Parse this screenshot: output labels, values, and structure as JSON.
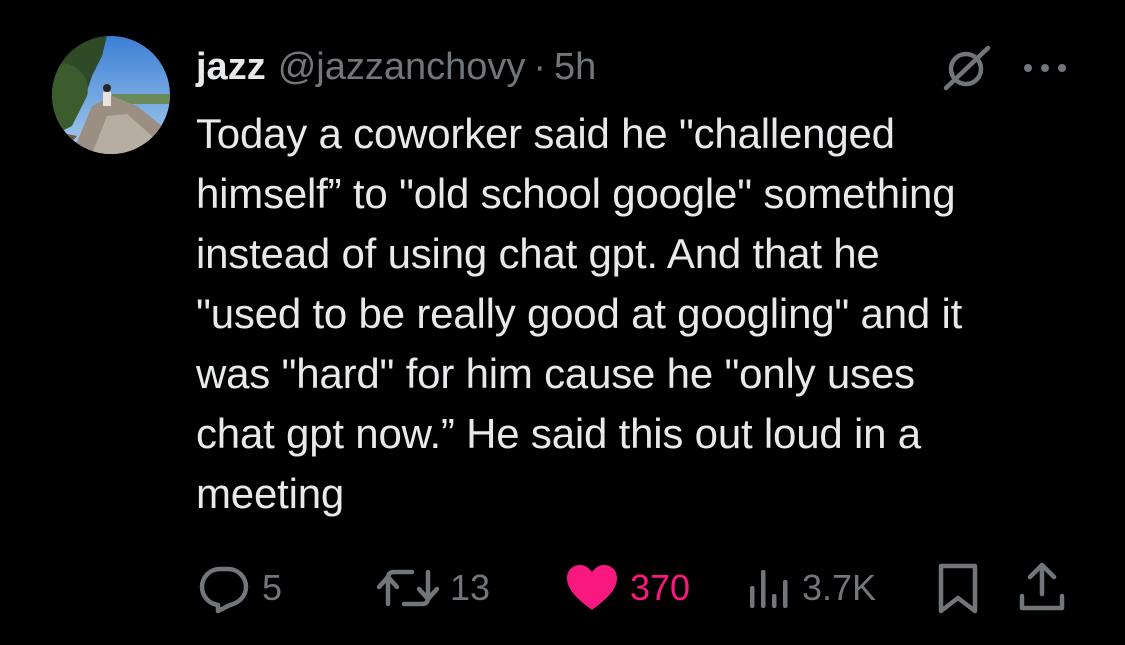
{
  "tweet": {
    "author": {
      "display_name": "jazz",
      "handle": "@jazzanchovy",
      "separator": "·",
      "time": "5h"
    },
    "text": "Today a coworker said he \"challenged\nhimself” to \"old school google\" something\ninstead of using chat gpt. And that he\n\"used to be really good at googling\" and it\nwas \"hard\" for him cause he \"only uses\nchat gpt now.” He said this out loud in a\nmeeting",
    "icons": {
      "avatar": "profile-photo",
      "grok": "grok-icon",
      "more": "more-dots-icon"
    },
    "actions": {
      "reply": {
        "icon": "reply-icon",
        "count": "5"
      },
      "retweet": {
        "icon": "retweet-icon",
        "count": "13"
      },
      "like": {
        "icon": "heart-icon",
        "count": "370",
        "liked": true
      },
      "views": {
        "icon": "views-icon",
        "count": "3.7K"
      },
      "bookmark": {
        "icon": "bookmark-icon"
      },
      "share": {
        "icon": "share-icon"
      }
    },
    "colors": {
      "background": "#000000",
      "text": "#e7e9ea",
      "muted": "#71767b",
      "like": "#f91880"
    }
  }
}
